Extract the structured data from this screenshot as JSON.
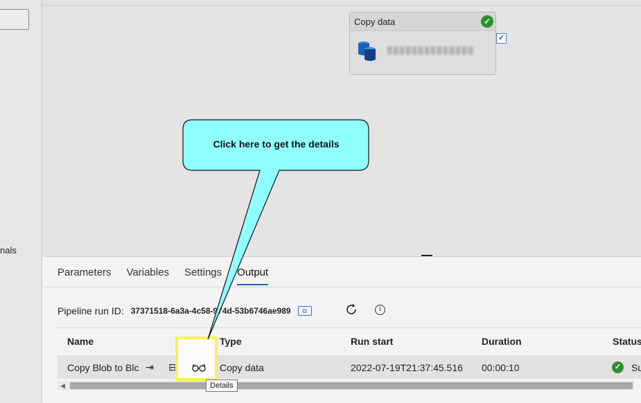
{
  "left": {
    "label": "nals"
  },
  "activity": {
    "title": "Copy data"
  },
  "tabs": [
    "Parameters",
    "Variables",
    "Settings",
    "Output"
  ],
  "run": {
    "label": "Pipeline run ID:",
    "id": "37371518-6a3a-4c58-974d-53b6746ae989"
  },
  "table": {
    "headers": {
      "name": "Name",
      "type": "Type",
      "run_start": "Run start",
      "duration": "Duration",
      "status": "Status"
    },
    "row": {
      "name": "Copy Blob to Blc",
      "type": "Copy data",
      "run_start": "2022-07-19T21:37:45.516",
      "duration": "00:00:10",
      "status": "Su"
    }
  },
  "tooltip": "Details",
  "callout": {
    "text": "Click here to get the details"
  },
  "colors": {
    "callout_fill": "#8fffff",
    "highlight": "#f3f35a",
    "success": "#2f8f2f",
    "tab_underline": "#2a5ea8"
  },
  "icons": [
    "database-icon",
    "success-check-icon",
    "copy-icon",
    "refresh-icon",
    "info-icon",
    "input-icon",
    "output-icon",
    "glasses-icon"
  ]
}
